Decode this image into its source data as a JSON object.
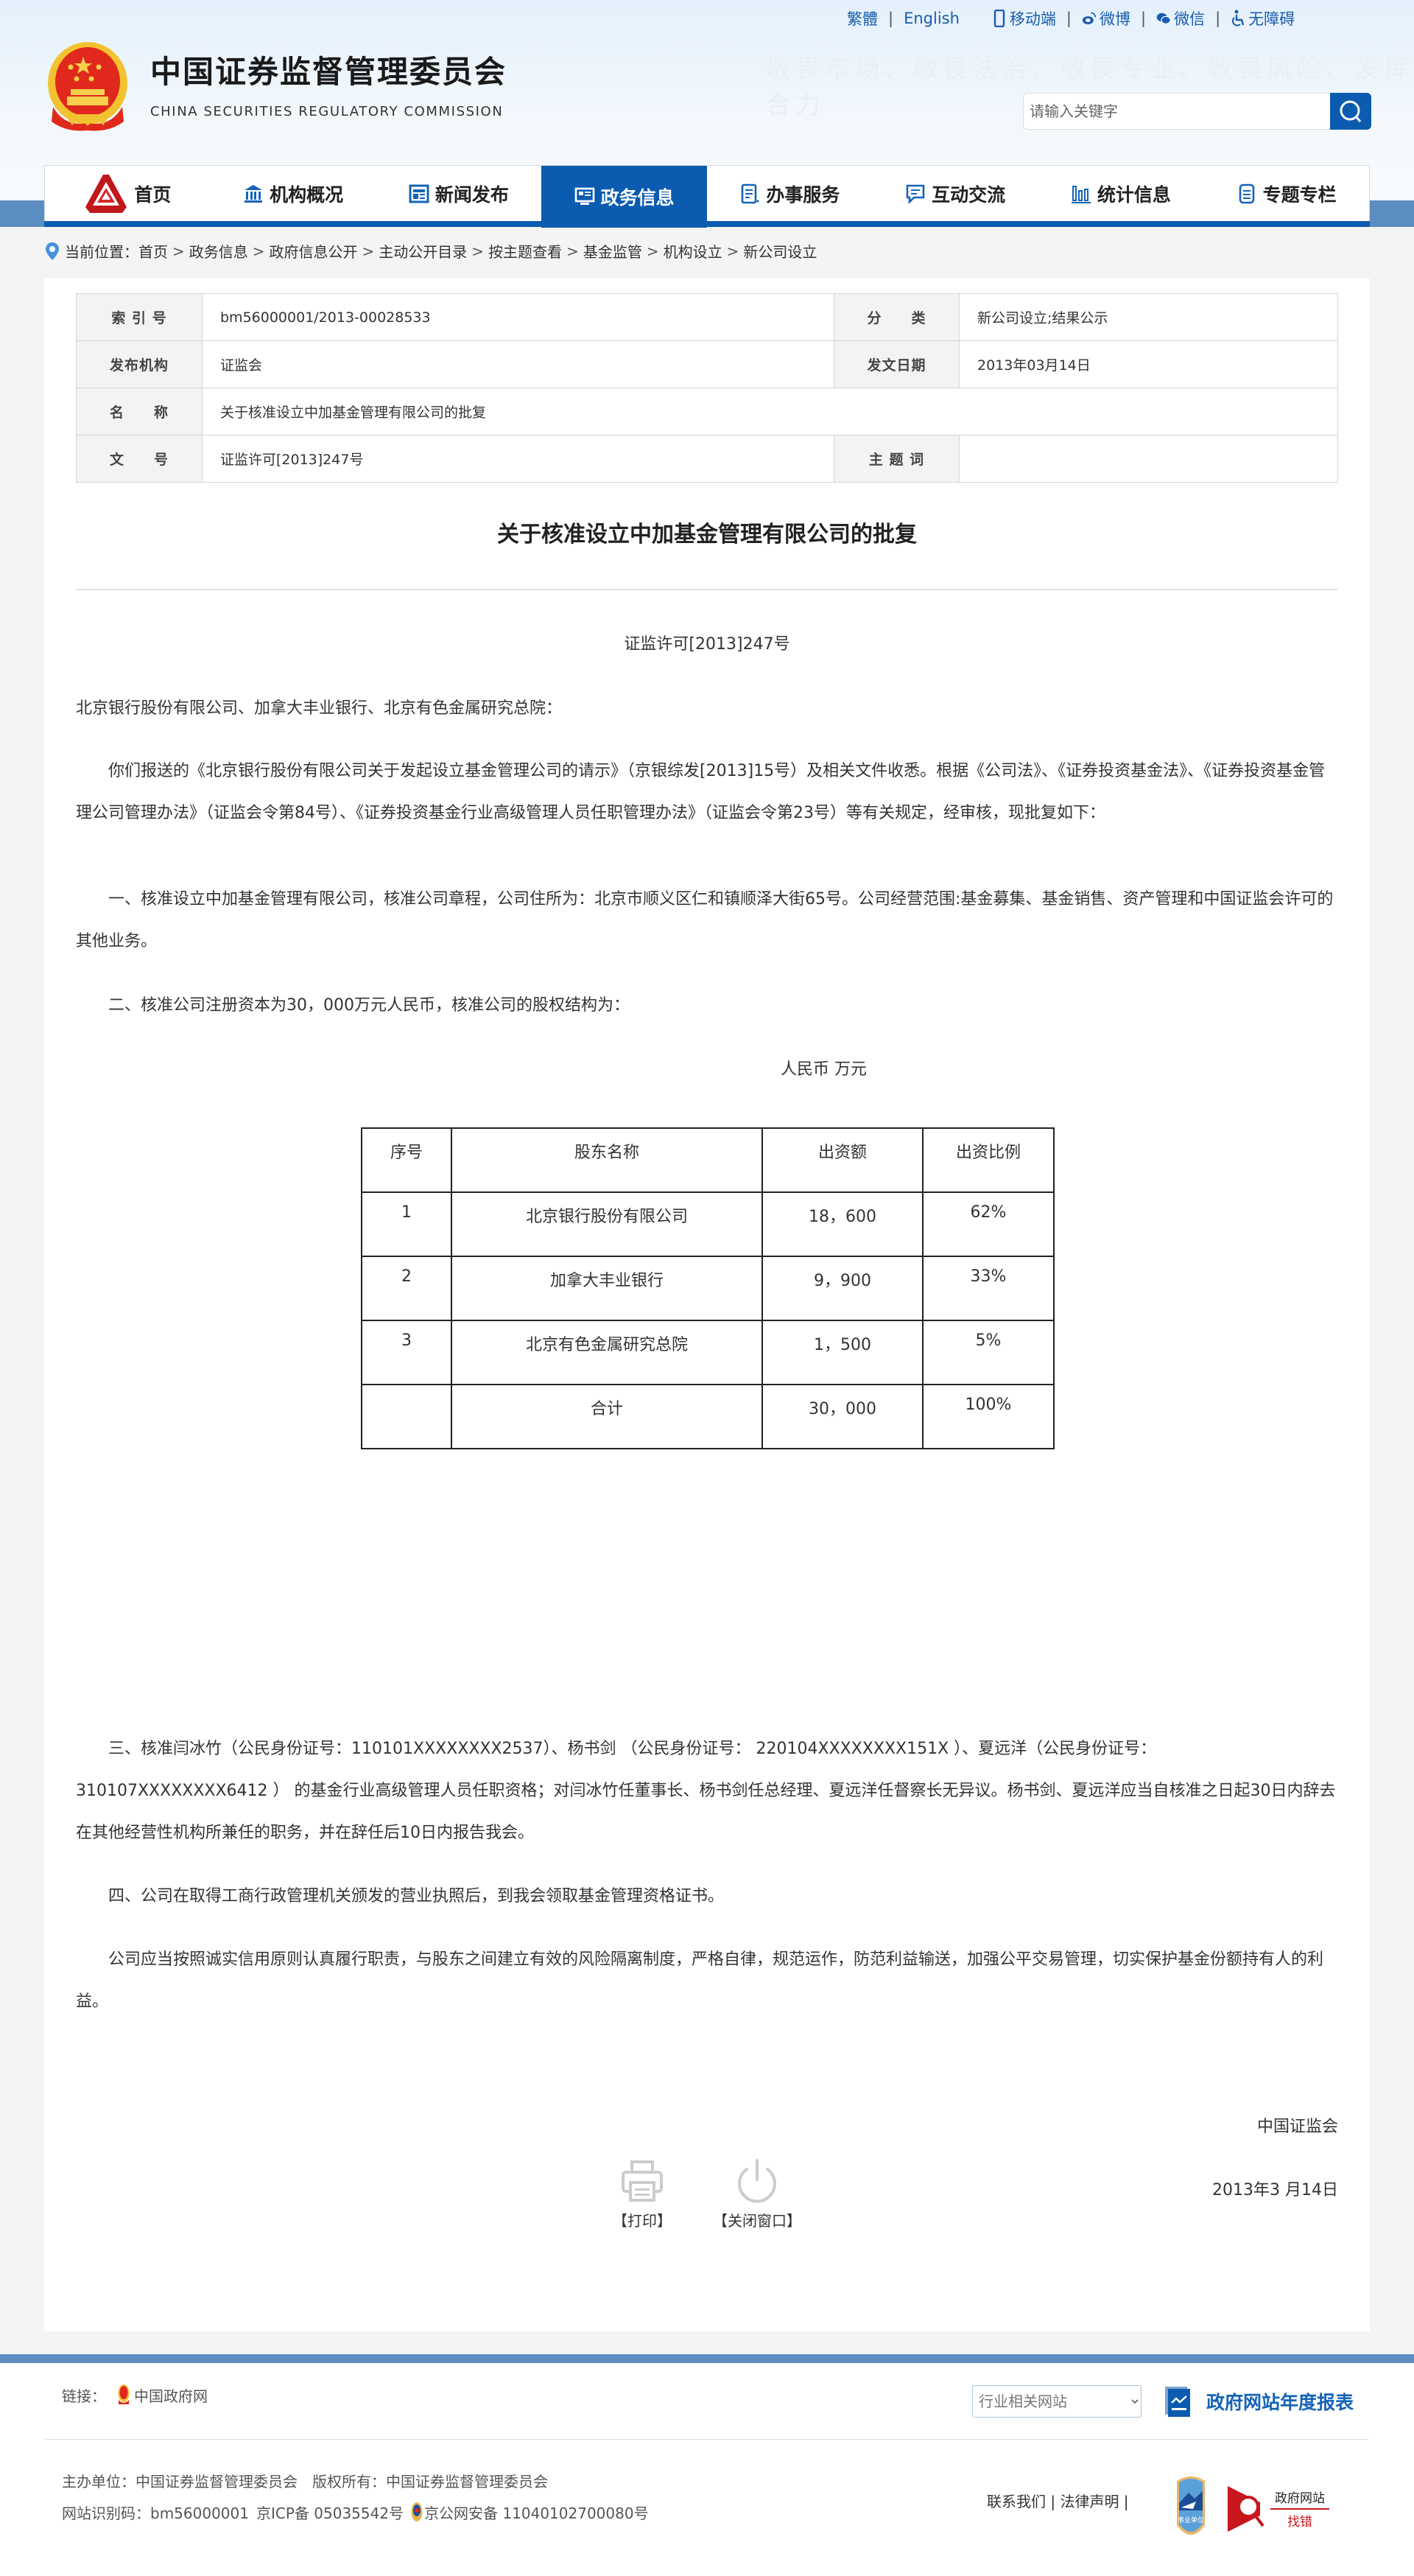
{
  "header": {
    "title_cn": "中国证券监督管理委员会",
    "title_en": "CHINA SECURITIES REGULATORY COMMISSION",
    "slogan": "敬畏市场、敬畏法治、敬畏专业、敬畏风险、发挥合力",
    "lang_links": [
      "繁體",
      "English"
    ],
    "service_links": [
      {
        "label": "移动端",
        "icon": "mobile-icon"
      },
      {
        "label": "微博",
        "icon": "weibo-icon"
      },
      {
        "label": "微信",
        "icon": "wechat-icon"
      },
      {
        "label": "无障碍",
        "icon": "accessibility-icon"
      }
    ],
    "search": {
      "placeholder": "请输入关键字",
      "value": ""
    }
  },
  "nav": {
    "items": [
      {
        "label": "首页",
        "icon": "csrc-logo-icon"
      },
      {
        "label": "机构概况",
        "icon": "institution-icon"
      },
      {
        "label": "新闻发布",
        "icon": "news-icon"
      },
      {
        "label": "政务信息",
        "icon": "gov-info-icon",
        "active": true
      },
      {
        "label": "办事服务",
        "icon": "service-icon"
      },
      {
        "label": "互动交流",
        "icon": "chat-icon"
      },
      {
        "label": "统计信息",
        "icon": "statistics-icon"
      },
      {
        "label": "专题专栏",
        "icon": "topic-icon"
      }
    ],
    "active_color": "#0b5cb0"
  },
  "breadcrumb": {
    "label": "当前位置：",
    "items": [
      "首页",
      "政务信息",
      "政府信息公开",
      "主动公开目录",
      "按主题查看",
      "基金监管",
      "机构设立",
      "新公司设立"
    ]
  },
  "meta": {
    "index_no_label": "索 引 号",
    "index_no": "bm56000001/2013-00028533",
    "category_label": "分　　类",
    "category": "新公司设立;结果公示",
    "publisher_label": "发布机构",
    "publisher": "证监会",
    "date_label": "发文日期",
    "date": "2013年03月14日",
    "name_label": "名　　称",
    "name": "关于核准设立中加基金管理有限公司的批复",
    "doc_no_label": "文　　号",
    "doc_no": "证监许可[2013]247号",
    "keywords_label": "主 题 词",
    "keywords": ""
  },
  "document": {
    "title": "关于核准设立中加基金管理有限公司的批复",
    "doc_no": "证监许可[2013]247号",
    "addressee": "北京银行股份有限公司、加拿大丰业银行、北京有色金属研究总院：",
    "para1": "你们报送的《北京银行股份有限公司关于发起设立基金管理公司的请示》（京银综发[2013]15号）及相关文件收悉。根据《公司法》、《证券投资基金法》、《证券投资基金管理公司管理办法》（证监会令第84号）、《证券投资基金行业高级管理人员任职管理办法》（证监会令第23号）等有关规定，经审核，现批复如下：",
    "para2": "一、核准设立中加基金管理有限公司，核准公司章程，公司住所为：北京市顺义区仁和镇顺泽大街65号。公司经营范围:基金募集、基金销售、资产管理和中国证监会许可的其他业务。",
    "para3": "二、核准公司注册资本为30，000万元人民币，核准公司的股权结构为：",
    "unit": "人民币 万元",
    "table": {
      "headers": [
        "序号",
        "股东名称",
        "出资额",
        "出资比例"
      ],
      "rows": [
        [
          "1",
          "北京银行股份有限公司",
          "18，600",
          "62%"
        ],
        [
          "2",
          "加拿大丰业银行",
          "9，900",
          "33%"
        ],
        [
          "3",
          "北京有色金属研究总院",
          "1，500",
          "5%"
        ],
        [
          "",
          "合计",
          "30，000",
          "100%"
        ]
      ]
    },
    "para4": "三、核准闫冰竹（公民身份证号：110101XXXXXXXX2537）、杨书剑 （公民身份证号： 220104XXXXXXXX151X ）、夏远洋（公民身份证号：310107XXXXXXXX6412 ） 的基金行业高级管理人员任职资格；对闫冰竹任董事长、杨书剑任总经理、夏远洋任督察长无异议。杨书剑、夏远洋应当自核准之日起30日内辞去在其他经营性机构所兼任的职务，并在辞任后10日内报告我会。",
    "para5": "四、公司在取得工商行政管理机关颁发的营业执照后，到我会领取基金管理资格证书。",
    "para6": "公司应当按照诚实信用原则认真履行职责，与股东之间建立有效的风险隔离制度，严格自律，规范运作，防范利益输送，加强公平交易管理，切实保护基金份额持有人的利益。",
    "signature": "中国证监会",
    "sign_date": "2013年3 月14日"
  },
  "tools": {
    "print": "【打印】",
    "close": "【关闭窗口】"
  },
  "footer": {
    "links_label": "链接：",
    "gov_link": "中国政府网",
    "select_placeholder": "行业相关网站",
    "annual_report": "政府网站年度报表",
    "sponsor": "主办单位：中国证券监督管理委员会",
    "copyright": "版权所有：中国证券监督管理委员会",
    "site_code": "网站识别码：bm56000001",
    "icp": "京ICP备 05035542号",
    "police": "京公网安备 11040102700080号",
    "contact": "联系我们",
    "legal": "法律声明",
    "badge_public": "事业单位",
    "badge_error_title": "政府网站",
    "badge_error_sub": "找错"
  }
}
